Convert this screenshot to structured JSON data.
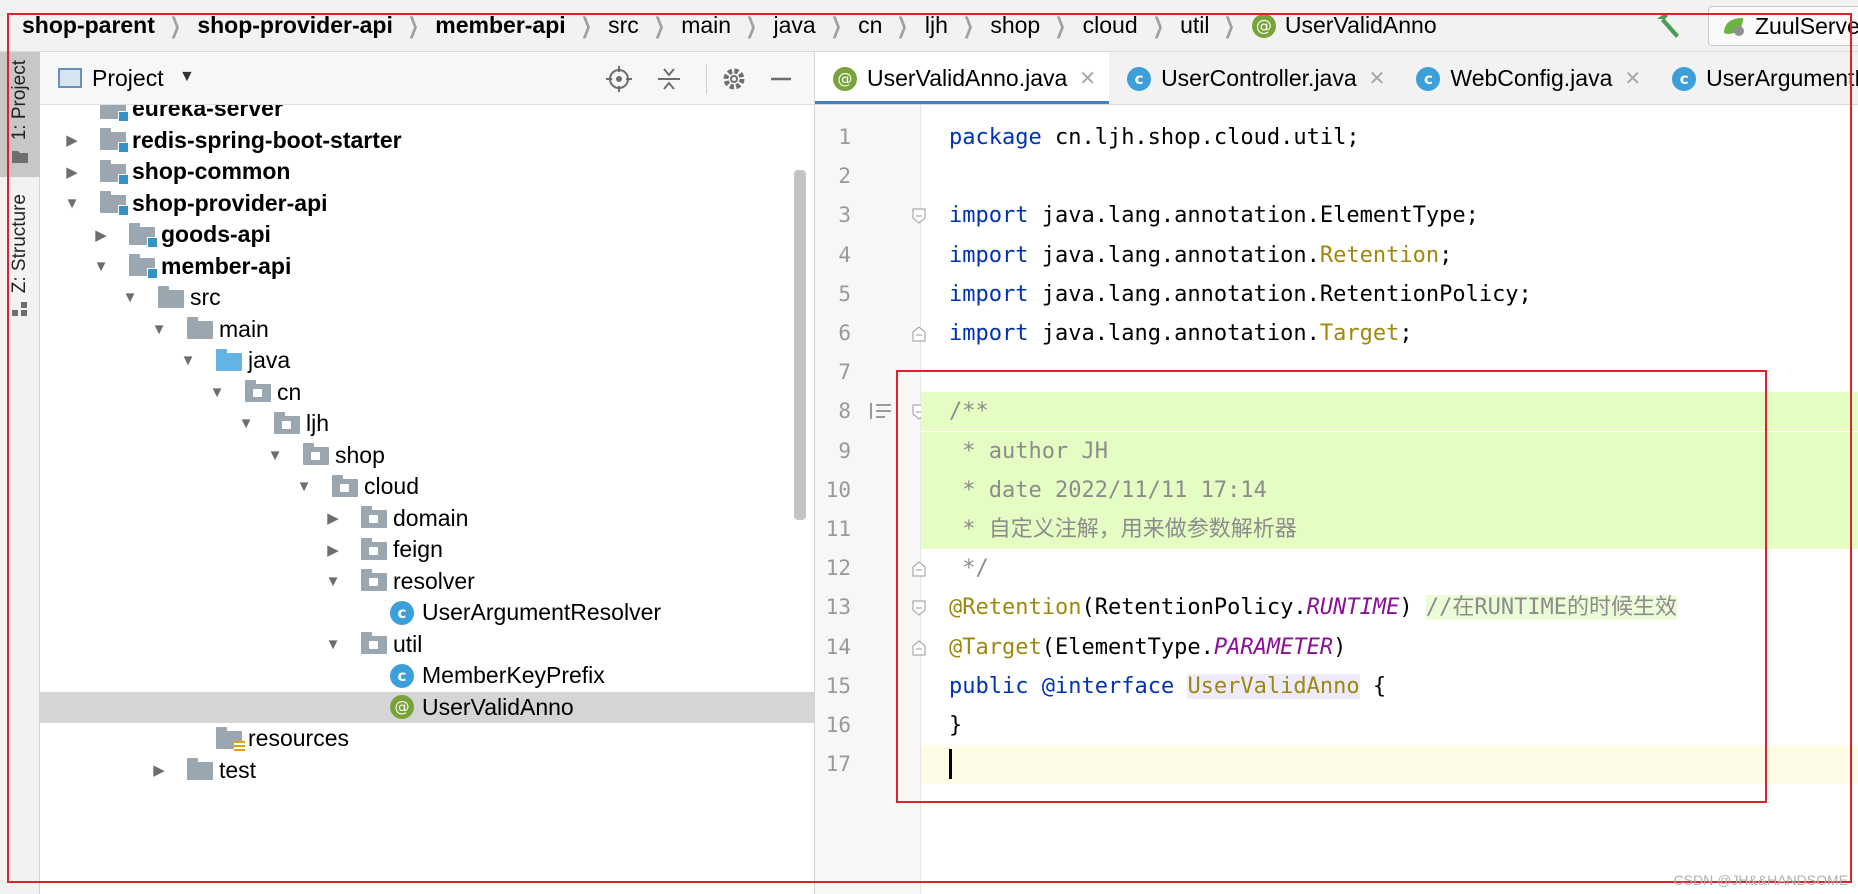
{
  "breadcrumb": [
    {
      "label": "shop-parent",
      "bold": true
    },
    {
      "label": "shop-provider-api",
      "bold": true
    },
    {
      "label": "member-api",
      "bold": true
    },
    {
      "label": "src",
      "bold": false
    },
    {
      "label": "main",
      "bold": false
    },
    {
      "label": "java",
      "bold": false
    },
    {
      "label": "cn",
      "bold": false
    },
    {
      "label": "ljh",
      "bold": false
    },
    {
      "label": "shop",
      "bold": false
    },
    {
      "label": "cloud",
      "bold": false
    },
    {
      "label": "util",
      "bold": false
    },
    {
      "label": "UserValidAnno",
      "bold": false,
      "icon": "annotation-icon"
    }
  ],
  "toolbar": {
    "run_config": "ZuulServer",
    "hammer_icon": "hammer-icon"
  },
  "tool_strip": {
    "project_tab": "1: Project",
    "structure_tab": "Z: Structure"
  },
  "project_panel": {
    "title": "Project",
    "header_buttons": [
      "locate-icon",
      "collapse-all-icon",
      "gear-icon",
      "hide-icon"
    ],
    "tree": [
      {
        "label": "eureka-server",
        "depth": 1,
        "arrow": "none",
        "icon": "module-folder",
        "bold": true
      },
      {
        "label": "redis-spring-boot-starter",
        "depth": 1,
        "arrow": "collapsed",
        "icon": "module-folder",
        "bold": true
      },
      {
        "label": "shop-common",
        "depth": 1,
        "arrow": "collapsed",
        "icon": "module-folder",
        "bold": true
      },
      {
        "label": "shop-provider-api",
        "depth": 1,
        "arrow": "expanded",
        "icon": "module-folder",
        "bold": true
      },
      {
        "label": "goods-api",
        "depth": 2,
        "arrow": "collapsed",
        "icon": "module-folder",
        "bold": true
      },
      {
        "label": "member-api",
        "depth": 2,
        "arrow": "expanded",
        "icon": "module-folder",
        "bold": true
      },
      {
        "label": "src",
        "depth": 3,
        "arrow": "expanded",
        "icon": "folder",
        "bold": false
      },
      {
        "label": "main",
        "depth": 4,
        "arrow": "expanded",
        "icon": "folder",
        "bold": false
      },
      {
        "label": "java",
        "depth": 5,
        "arrow": "expanded",
        "icon": "source-folder",
        "bold": false
      },
      {
        "label": "cn",
        "depth": 6,
        "arrow": "expanded",
        "icon": "package",
        "bold": false
      },
      {
        "label": "ljh",
        "depth": 7,
        "arrow": "expanded",
        "icon": "package",
        "bold": false
      },
      {
        "label": "shop",
        "depth": 8,
        "arrow": "expanded",
        "icon": "package",
        "bold": false
      },
      {
        "label": "cloud",
        "depth": 9,
        "arrow": "expanded",
        "icon": "package",
        "bold": false
      },
      {
        "label": "domain",
        "depth": 10,
        "arrow": "collapsed",
        "icon": "package",
        "bold": false
      },
      {
        "label": "feign",
        "depth": 10,
        "arrow": "collapsed",
        "icon": "package",
        "bold": false
      },
      {
        "label": "resolver",
        "depth": 10,
        "arrow": "expanded",
        "icon": "package",
        "bold": false
      },
      {
        "label": "UserArgumentResolver",
        "depth": 11,
        "arrow": "none",
        "icon": "class",
        "bold": false
      },
      {
        "label": "util",
        "depth": 10,
        "arrow": "expanded",
        "icon": "package",
        "bold": false
      },
      {
        "label": "MemberKeyPrefix",
        "depth": 11,
        "arrow": "none",
        "icon": "class",
        "bold": false
      },
      {
        "label": "UserValidAnno",
        "depth": 11,
        "arrow": "none",
        "icon": "annotation",
        "bold": false,
        "selected": true
      },
      {
        "label": "resources",
        "depth": 5,
        "arrow": "none",
        "icon": "resources-folder",
        "bold": false
      },
      {
        "label": "test",
        "depth": 4,
        "arrow": "collapsed",
        "icon": "folder",
        "bold": false
      }
    ]
  },
  "editor": {
    "tabs": [
      {
        "label": "UserValidAnno.java",
        "icon": "annotation",
        "active": true,
        "closable": true
      },
      {
        "label": "UserController.java",
        "icon": "class",
        "active": false,
        "closable": true
      },
      {
        "label": "WebConfig.java",
        "icon": "class",
        "active": false,
        "closable": true
      },
      {
        "label": "UserArgumentResolver.java",
        "icon": "class",
        "active": false,
        "closable": false
      }
    ],
    "lines": [
      {
        "n": "1",
        "tokens": [
          [
            "kw",
            "package"
          ],
          [
            "",
            " cn.ljh.shop.cloud.util;"
          ]
        ]
      },
      {
        "n": "2",
        "tokens": []
      },
      {
        "n": "3",
        "tokens": [
          [
            "kw",
            "import"
          ],
          [
            "",
            " java.lang.annotation.ElementType;"
          ]
        ]
      },
      {
        "n": "4",
        "tokens": [
          [
            "kw",
            "import"
          ],
          [
            "",
            " java.lang.annotation."
          ],
          [
            "ret-cls",
            "Retention"
          ],
          [
            "",
            ";"
          ]
        ]
      },
      {
        "n": "5",
        "tokens": [
          [
            "kw",
            "import"
          ],
          [
            "",
            " java.lang.annotation.RetentionPolicy;"
          ]
        ]
      },
      {
        "n": "6",
        "tokens": [
          [
            "kw",
            "import"
          ],
          [
            "",
            " java.lang.annotation."
          ],
          [
            "ret-cls",
            "Target"
          ],
          [
            "",
            ";"
          ]
        ]
      },
      {
        "n": "7",
        "tokens": []
      },
      {
        "n": "8",
        "tokens": [
          [
            "cmt-plain",
            "/**"
          ]
        ],
        "hl": true
      },
      {
        "n": "9",
        "tokens": [
          [
            "cmt-plain",
            " * author JH"
          ]
        ],
        "hl": true
      },
      {
        "n": "10",
        "tokens": [
          [
            "cmt-plain",
            " * date 2022/11/11 17:14"
          ]
        ],
        "hl": true
      },
      {
        "n": "11",
        "tokens": [
          [
            "cmt-plain",
            " * 自定义注解，用来做参数解析器"
          ]
        ],
        "hl": true
      },
      {
        "n": "12",
        "tokens": [
          [
            "cmt-plain",
            " */"
          ]
        ]
      },
      {
        "n": "13",
        "tokens": [
          [
            "anno",
            "@Retention"
          ],
          [
            "",
            "(RetentionPolicy."
          ],
          [
            "const",
            "RUNTIME"
          ],
          [
            "",
            ") "
          ],
          [
            "cmt-plain lc-hl",
            "//在RUNTIME的时候生效"
          ]
        ]
      },
      {
        "n": "14",
        "tokens": [
          [
            "anno",
            "@Target"
          ],
          [
            "",
            "(ElementType."
          ],
          [
            "const",
            "PARAMETER"
          ],
          [
            "",
            ")"
          ]
        ]
      },
      {
        "n": "15",
        "tokens": [
          [
            "kw",
            "public"
          ],
          [
            "",
            " "
          ],
          [
            "iface",
            "@interface"
          ],
          [
            "",
            " "
          ],
          [
            "ret-cls usage-hl",
            "UserValidAnno"
          ],
          [
            "",
            " {"
          ]
        ]
      },
      {
        "n": "16",
        "tokens": [
          [
            "",
            "}"
          ]
        ]
      },
      {
        "n": "17",
        "tokens": [],
        "current": true
      }
    ]
  },
  "watermark": "CSDN @JH&&HANDSOME",
  "colors": {
    "accent_tab": "#4083c9",
    "highlight_box": "#e0202a",
    "doc_highlight": "#e4fdc2",
    "current_line": "#fefbe6",
    "keyword": "#0033b3",
    "annotation": "#9e880d",
    "constant": "#871094"
  }
}
